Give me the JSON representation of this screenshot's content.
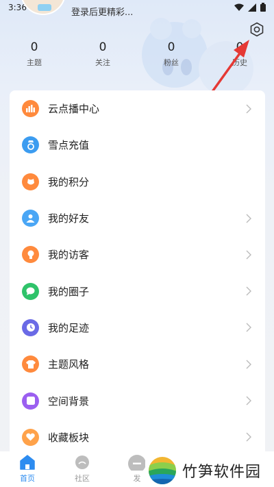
{
  "status": {
    "time": "3:36"
  },
  "profile": {
    "login_hint": "登录后更精彩..."
  },
  "stats": [
    {
      "value": "0",
      "label": "主题"
    },
    {
      "value": "0",
      "label": "关注"
    },
    {
      "value": "0",
      "label": "粉丝"
    },
    {
      "value": "0",
      "label": "历史"
    }
  ],
  "menu": [
    {
      "label": "云点播中心",
      "icon": "bars-icon",
      "color": "#ff8a3d",
      "chevron": true
    },
    {
      "label": "雪点充值",
      "icon": "ring-icon",
      "color": "#3c9cf0",
      "chevron": false
    },
    {
      "label": "我的积分",
      "icon": "pouch-icon",
      "color": "#ff8a3d",
      "chevron": false
    },
    {
      "label": "我的好友",
      "icon": "person-icon",
      "color": "#4aa6f5",
      "chevron": true
    },
    {
      "label": "我的访客",
      "icon": "bulb-icon",
      "color": "#ff8a3d",
      "chevron": true
    },
    {
      "label": "我的圈子",
      "icon": "chat-icon",
      "color": "#2fc36a",
      "chevron": true
    },
    {
      "label": "我的足迹",
      "icon": "clock-icon",
      "color": "#6a6ae6",
      "chevron": true
    },
    {
      "label": "主题风格",
      "icon": "shirt-icon",
      "color": "#ff8a3d",
      "chevron": true
    },
    {
      "label": "空间背景",
      "icon": "square-icon",
      "color": "#9b5ff0",
      "chevron": true
    },
    {
      "label": "收藏板块",
      "icon": "heart-icon",
      "color": "#ffa24a",
      "chevron": true
    }
  ],
  "nav": {
    "home": "首页",
    "community": "社区",
    "post": "发"
  },
  "watermark": {
    "text": "竹笋软件园"
  },
  "colors": {
    "accent": "#2d8cf0",
    "arrow": "#e53935"
  }
}
